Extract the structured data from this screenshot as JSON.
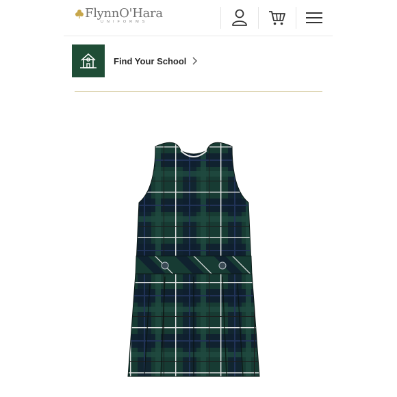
{
  "header": {
    "logo_name": "FlynnO'Hara",
    "logo_sub": "UNIFORMS",
    "account_icon": "user-icon",
    "cart_icon": "cart-icon",
    "menu_icon": "hamburger-menu-icon"
  },
  "school_finder": {
    "label": "Find Your School",
    "icon": "schoolhouse-icon"
  },
  "product": {
    "image": "green-tartan-plaid-jumper-dress"
  },
  "colors": {
    "brand_green": "#1f4d36",
    "plaid_dark": "#163a32",
    "plaid_navy": "#1c2a4a",
    "divider_gold": "#d9cfa9"
  }
}
